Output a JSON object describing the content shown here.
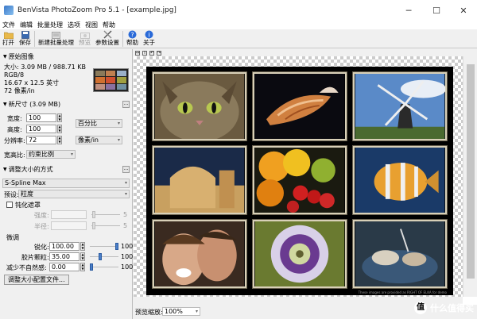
{
  "window": {
    "title": "BenVista PhotoZoom Pro 5.1 - [example.jpg]",
    "minimize": "─",
    "maximize": "☐",
    "close": "✕"
  },
  "menu": [
    "文件",
    "编辑",
    "批量处理",
    "选项",
    "视图",
    "帮助"
  ],
  "toolbar": {
    "open": "打开",
    "save": "保存",
    "new_batch": "新建批量处理",
    "preview": "预览",
    "param_settings": "参数设置",
    "help": "帮助",
    "about": "关于"
  },
  "original": {
    "header": "原始图像",
    "size": "大小: 3.09 MB / 988.71 KB",
    "mode": "RGB/8",
    "dims": "16.67 x 12.5 英寸",
    "res": "72 像素/in"
  },
  "new_size": {
    "header": "新尺寸 (3.09 MB)",
    "width_label": "宽度:",
    "width_value": "100",
    "height_label": "高度:",
    "height_value": "100",
    "unit": "百分比",
    "res_label": "分辨率:",
    "res_value": "72",
    "res_unit": "像素/in",
    "aspect_label": "宽高比:",
    "aspect_value": "约束比例"
  },
  "resize_method": {
    "header": "调整大小的方式",
    "method": "S-Spline Max",
    "preset_label": "预设:",
    "preset_value": "粒度",
    "unsharp_label": "钝化遮罩",
    "strength_label": "强度:",
    "strength_value": "5",
    "radius_label": "半径:",
    "radius_value": "5",
    "fine_label": "微调",
    "sharpen_label": "锐化:",
    "sharpen_value": "100.00",
    "sharpen_max": "100",
    "sharpen_level": 1.0,
    "grain_label": "胶片颗粒:",
    "grain_value": "35.00",
    "grain_max": "100",
    "grain_level": 0.35,
    "artifact_label": "减少不自然感:",
    "artifact_value": "0.00",
    "artifact_max": "100",
    "artifact_level": 0.0,
    "profile_button": "调整大小配置文件..."
  },
  "preview": {
    "zoom_label": "预览缩放:",
    "zoom_value": "100%",
    "credit": "These images are provided as RIGHT OF ELKA for demo",
    "mini_toolbar": [
      "↔",
      "I",
      "↶",
      "↷"
    ]
  },
  "watermark": {
    "text": "什么值得买",
    "glyph": "值"
  }
}
